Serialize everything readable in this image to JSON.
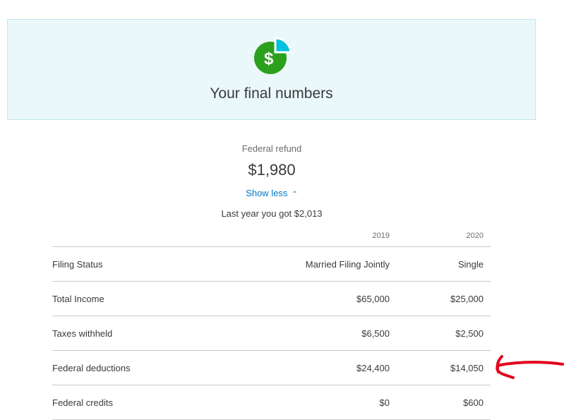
{
  "banner": {
    "title": "Your final numbers"
  },
  "refund": {
    "label": "Federal refund",
    "amount": "$1,980",
    "toggle_label": "Show less",
    "last_year": "Last year you got $2,013"
  },
  "table": {
    "years": [
      "2019",
      "2020"
    ],
    "rows": [
      {
        "label": "Filing Status",
        "y2019": "Married Filing Jointly",
        "y2020": "Single"
      },
      {
        "label": "Total Income",
        "y2019": "$65,000",
        "y2020": "$25,000"
      },
      {
        "label": "Taxes withheld",
        "y2019": "$6,500",
        "y2020": "$2,500"
      },
      {
        "label": "Federal deductions",
        "y2019": "$24,400",
        "y2020": "$14,050"
      },
      {
        "label": "Federal credits",
        "y2019": "$0",
        "y2020": "$600"
      }
    ]
  },
  "icons": {
    "banner": "pie-chart-dollar-icon",
    "toggle": "chevron-up-icon",
    "annotation": "red-arrow-annotation"
  },
  "colors": {
    "accent": "#0077c5",
    "banner_bg": "#ebf8fa",
    "icon_green": "#2ca01c",
    "icon_blue": "#00c1de",
    "annotation": "#e2001a"
  }
}
